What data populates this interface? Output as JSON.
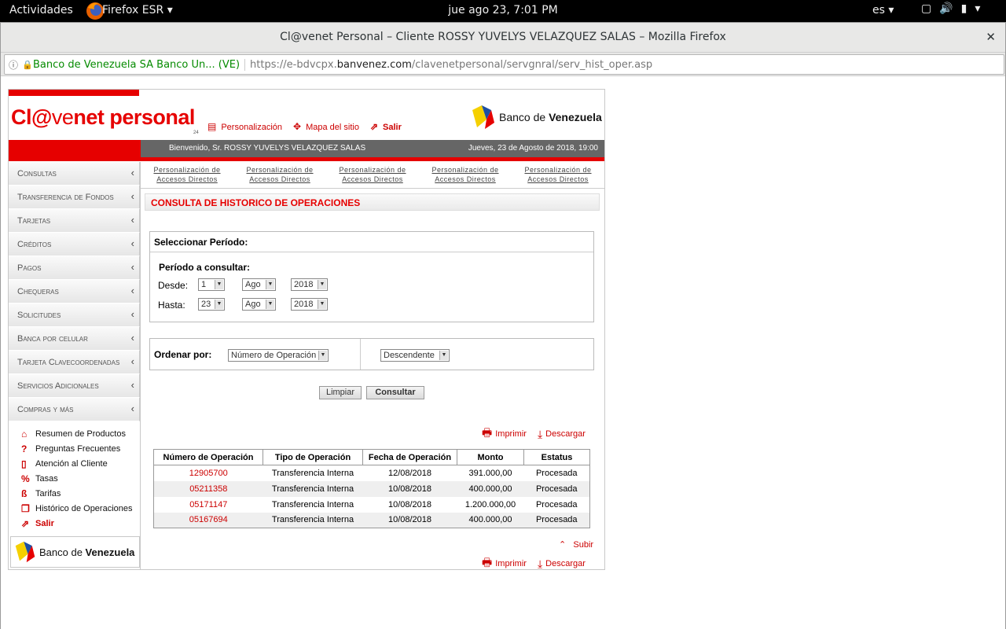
{
  "topbar": {
    "activities": "Actividades",
    "app": "Firefox ESR",
    "clock": "jue ago 23,  7:01 PM",
    "lang": "es"
  },
  "window": {
    "title": "Cl@venet Personal – Cliente ROSSY YUVELYS VELAZQUEZ SALAS – Mozilla Firefox"
  },
  "url": {
    "org": "Banco de Venezuela SA Banco Un... (VE)",
    "prefix": "https://e-bdvcpx.",
    "domain": "banvenez.com",
    "path": "/clavenetpersonal/servgnral/serv_hist_oper.asp"
  },
  "site": {
    "logo_a": "Cl@",
    "logo_b": "ve",
    "logo_c": "net personal",
    "logo_sub": "24",
    "links": [
      "Personalización",
      "Mapa del sitio",
      "Salir"
    ],
    "bank_name_a": "Banco de ",
    "bank_name_b": "Venezuela",
    "welcome": "Bienvenido, Sr.  ROSSY YUVELYS VELAZQUEZ SALAS",
    "date": "Jueves, 23 de Agosto de 2018, 19:00"
  },
  "sidebar": {
    "menu": [
      "Consultas",
      "Transferencia de Fondos",
      "Tarjetas",
      "Créditos",
      "Pagos",
      "Chequeras",
      "Solicitudes",
      "Banca por celular",
      "Tarjeta Clavecoordenadas",
      "Servicios Adicionales",
      "Compras y más"
    ],
    "quick": [
      "Resumen de Productos",
      "Preguntas Frecuentes",
      "Atención al Cliente",
      "Tasas",
      "Tarifas",
      "Histórico de Operaciones",
      "Salir"
    ]
  },
  "access": {
    "line1": "Personalización de",
    "line2": "Accesos Directos"
  },
  "main": {
    "title": "CONSULTA DE HISTORICO DE OPERACIONES",
    "period_header": "Seleccionar Período:",
    "period_sub": "Período a consultar:",
    "desde": "Desde:",
    "hasta": "Hasta:",
    "desde_day": "1",
    "desde_month": "Ago",
    "desde_year": "2018",
    "hasta_day": "23",
    "hasta_month": "Ago",
    "hasta_year": "2018",
    "order_label": "Ordenar por:",
    "order_by": "Número de Operación",
    "order_dir": "Descendente",
    "clear": "Limpiar",
    "search": "Consultar",
    "print": "Imprimir",
    "download": "Descargar",
    "up": "Subir"
  },
  "table": {
    "headers": [
      "Número de Operación",
      "Tipo de Operación",
      "Fecha de Operación",
      "Monto",
      "Estatus"
    ],
    "rows": [
      [
        "12905700",
        "Transferencia Interna",
        "12/08/2018",
        "391.000,00",
        "Procesada"
      ],
      [
        "05211358",
        "Transferencia Interna",
        "10/08/2018",
        "400.000,00",
        "Procesada"
      ],
      [
        "05171147",
        "Transferencia Interna",
        "10/08/2018",
        "1.200.000,00",
        "Procesada"
      ],
      [
        "05167694",
        "Transferencia Interna",
        "10/08/2018",
        "400.000,00",
        "Procesada"
      ]
    ]
  },
  "colors": {
    "brand_red": "#e60000",
    "bar_gray": "#666666",
    "url_green": "#058b00"
  },
  "icons": [
    "firefox-icon",
    "screen-icon",
    "volume-icon",
    "battery-icon",
    "info-icon",
    "lock-icon",
    "bdv-logo-icon",
    "printer-icon",
    "download-icon",
    "chevron-up-icon"
  ]
}
